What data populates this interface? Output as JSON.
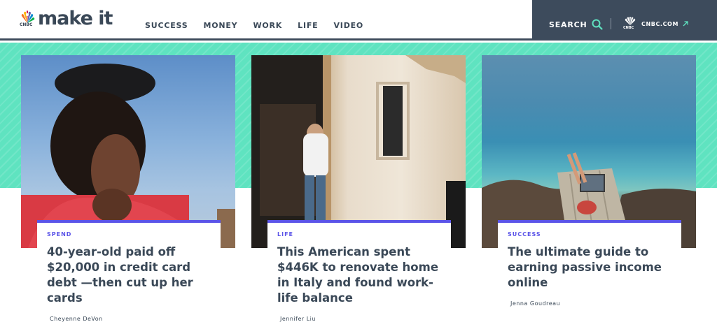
{
  "header": {
    "logo_text": "make it",
    "logo_sub": "CNBC",
    "nav": [
      "SUCCESS",
      "MONEY",
      "WORK",
      "LIFE",
      "VIDEO"
    ],
    "search_label": "SEARCH",
    "cnbc_link": "CNBC.COM",
    "cnbc_mini": "CNBC"
  },
  "colors": {
    "accent": "#5b54e8",
    "teal": "#5fe3c0",
    "navy": "#3d4b5c",
    "text": "#3a4857"
  },
  "cards": [
    {
      "tag": "SPEND",
      "title": "40-year-old paid off $20,000 in credit card debt —then cut up her cards",
      "author": "Cheyenne DeVon"
    },
    {
      "tag": "LIFE",
      "title": "This American spent $446K to renovate home in Italy and found work-life balance",
      "author": "Jennifer Liu"
    },
    {
      "tag": "SUCCESS",
      "title": "The ultimate guide to earning passive income online",
      "author": "Jenna Goudreau"
    }
  ]
}
